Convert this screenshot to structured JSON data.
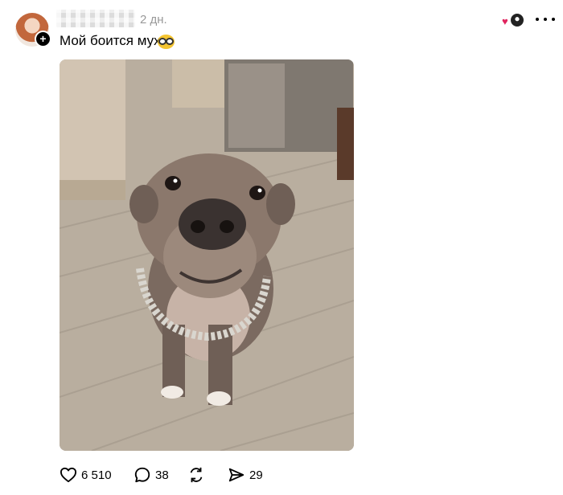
{
  "post": {
    "author": {
      "username": " ",
      "avatar_icon": "profile-avatar",
      "follow_icon": "plus-icon"
    },
    "time": "2 дн.",
    "caption": "Мой боится мух",
    "caption_emoji": "nerd-glasses-face-emoji",
    "photo_description_icon": "pitbull-dog-photo",
    "top_right": {
      "badge_icon": "heart-with-avatar-icon",
      "more_icon": "more-horizontal-icon"
    },
    "actions": {
      "likes": "6 510",
      "comments": "38",
      "reposts": "",
      "shares": "29"
    },
    "colors": {
      "heart": "#e0245e",
      "text": "#000000",
      "muted": "#999999"
    }
  }
}
